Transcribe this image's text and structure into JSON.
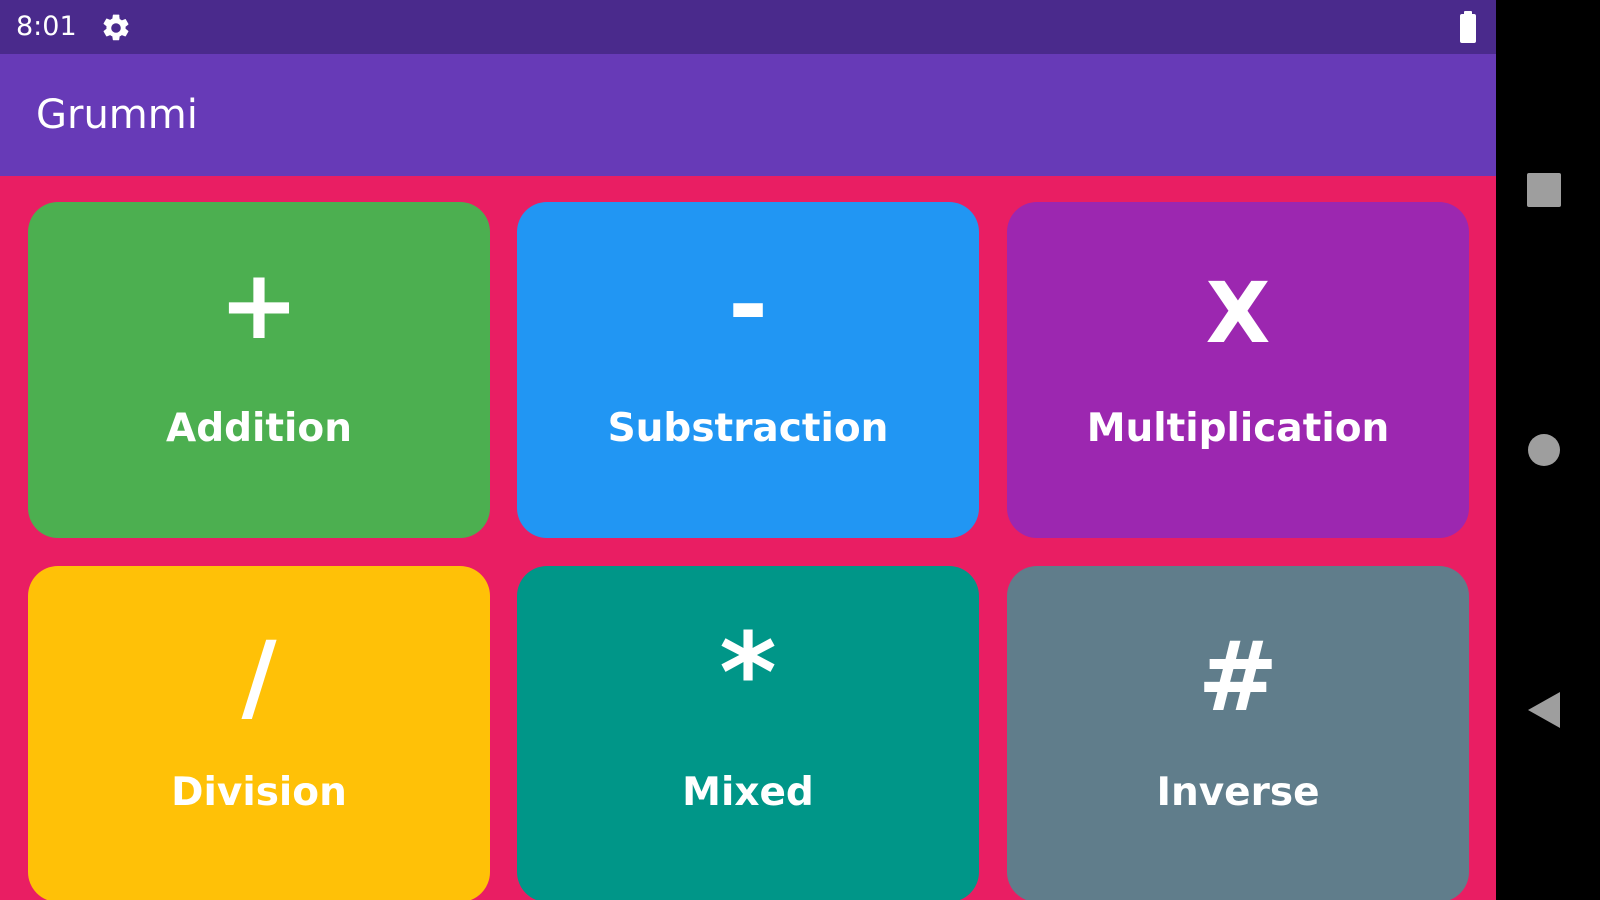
{
  "status_bar": {
    "time": "8:01",
    "settings_icon": "gear-icon",
    "battery_icon": "battery-icon"
  },
  "app_bar": {
    "title": "Grummi"
  },
  "operations": [
    {
      "symbol": "+",
      "label": "Addition",
      "color": "#4CAF50"
    },
    {
      "symbol": "-",
      "label": "Substraction",
      "color": "#2196F3"
    },
    {
      "symbol": "X",
      "label": "Multiplication",
      "color": "#9C27B0"
    },
    {
      "symbol": "/",
      "label": "Division",
      "color": "#FFC107"
    },
    {
      "symbol": "*",
      "label": "Mixed",
      "color": "#009688"
    },
    {
      "symbol": "#",
      "label": "Inverse",
      "color": "#607D8B"
    }
  ],
  "nav_bar": {
    "recents_icon": "square-icon",
    "home_icon": "circle-icon",
    "back_icon": "triangle-back-icon"
  },
  "colors": {
    "status_bar": "#4A2A8C",
    "app_bar": "#673AB7",
    "background": "#E91E63"
  }
}
